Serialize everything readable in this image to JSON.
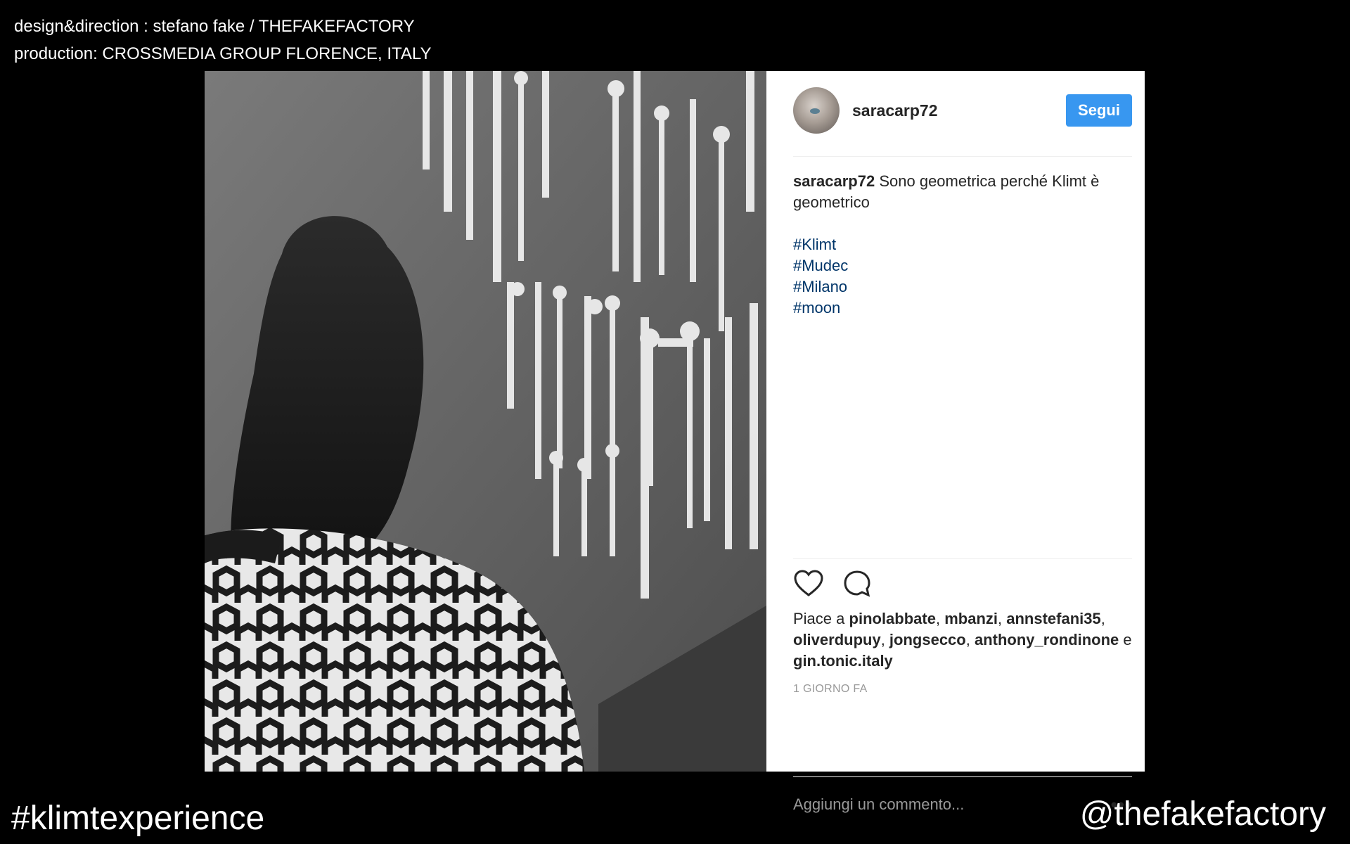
{
  "credits": {
    "line1": "design&direction : stefano fake / THEFAKEFACTORY",
    "line2": "production: CROSSMEDIA GROUP FLORENCE, ITALY"
  },
  "post": {
    "username": "saracarp72",
    "follow_label": "Segui",
    "caption": {
      "user": "saracarp72",
      "text": "Sono geometrica perché Klimt è geometrico",
      "hashtags": [
        "#Klimt",
        "#Mudec",
        "#Milano",
        "#moon"
      ]
    },
    "likes": {
      "prefix": "Piace a",
      "users": [
        "pinolabbate",
        "mbanzi",
        "annstefani35",
        "oliverdupuy",
        "jongsecco",
        "anthony_rondinone"
      ],
      "conjunction": "e",
      "last_user": "gin.tonic.italy"
    },
    "timestamp": "1 GIORNO FA",
    "comment_placeholder": "Aggiungi un commento...",
    "more_label": "•••",
    "icons": [
      "heart-icon",
      "comment-icon",
      "more-options-icon"
    ],
    "accent_color": "#3897f0"
  },
  "footer": {
    "hashtag": "#klimtexperience",
    "handle": "@thefakefactory"
  }
}
